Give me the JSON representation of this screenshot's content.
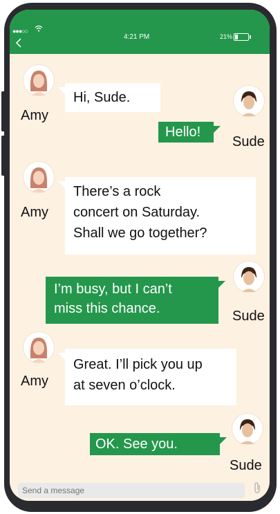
{
  "status": {
    "signal": "●●●○○",
    "time": "4:21 PM",
    "battery": "21%",
    "battery_level": 0.21
  },
  "header": {
    "back_icon": "chevron-left-icon"
  },
  "messages": [
    {
      "sender": "Amy",
      "side": "in",
      "lines": [
        "Hi, Sude."
      ]
    },
    {
      "sender": "Sude",
      "side": "out",
      "lines": [
        "Hello!"
      ]
    },
    {
      "sender": "Amy",
      "side": "in",
      "lines": [
        "There’s a rock",
        "concert on Saturday.",
        "Shall we go together?"
      ]
    },
    {
      "sender": "Sude",
      "side": "out",
      "lines": [
        "I’m busy, but I can’t",
        "miss this chance."
      ]
    },
    {
      "sender": "Amy",
      "side": "in",
      "lines": [
        "Great. I’ll pick you up",
        "at seven o’clock."
      ]
    },
    {
      "sender": "Sude",
      "side": "out",
      "lines": [
        "OK. See you."
      ]
    }
  ],
  "compose": {
    "placeholder": "Send a message",
    "attach_icon": "paperclip-icon"
  },
  "colors": {
    "accent": "#24974c",
    "background": "#fdf1e1"
  }
}
